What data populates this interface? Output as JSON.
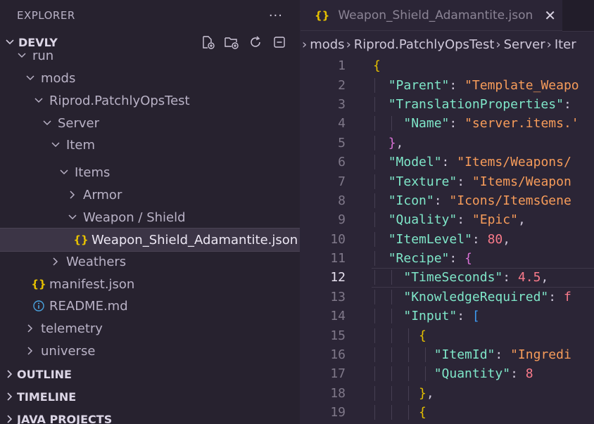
{
  "explorer": {
    "title": "EXPLORER",
    "more": "···"
  },
  "workspace": {
    "name": "DEVLY"
  },
  "tree": [
    {
      "label": "run",
      "depth": 1,
      "type": "folder",
      "expanded": true
    },
    {
      "label": "mods",
      "depth": 2,
      "type": "folder",
      "expanded": true
    },
    {
      "label": "Riprod.PatchlyOpsTest",
      "depth": 3,
      "type": "folder",
      "expanded": true
    },
    {
      "label": "Server",
      "depth": 4,
      "type": "folder",
      "expanded": true
    },
    {
      "label": "Item",
      "depth": 5,
      "type": "folder",
      "expanded": true
    },
    {
      "label": "Items",
      "depth": 6,
      "type": "folder",
      "expanded": true
    },
    {
      "label": "Armor",
      "depth": 7,
      "type": "folder",
      "expanded": false
    },
    {
      "label": "Weapon / Shield",
      "depth": 7,
      "type": "folder",
      "expanded": true
    },
    {
      "label": "Weapon_Shield_Adamantite.json",
      "depth": 8,
      "type": "json",
      "selected": true
    },
    {
      "label": "Weathers",
      "depth": 5,
      "type": "folder",
      "expanded": false
    },
    {
      "label": "manifest.json",
      "depth": 3,
      "type": "json"
    },
    {
      "label": "README.md",
      "depth": 3,
      "type": "info"
    },
    {
      "label": "telemetry",
      "depth": 2,
      "type": "folder",
      "expanded": false
    },
    {
      "label": "universe",
      "depth": 2,
      "type": "folder",
      "expanded": false
    }
  ],
  "sections": [
    "OUTLINE",
    "TIMELINE",
    "JAVA PROJECTS"
  ],
  "tab": {
    "label": "Weapon_Shield_Adamantite.json",
    "brace": "{}",
    "close": "✕"
  },
  "breadcrumbs": [
    "mods",
    "Riprod.PatchlyOpsTest",
    "Server",
    "Iter"
  ],
  "active_line": 12,
  "code_lines": [
    {
      "n": 1,
      "indent": 0,
      "tokens": [
        [
          "b1",
          "{"
        ]
      ]
    },
    {
      "n": 2,
      "indent": 1,
      "tokens": [
        [
          "k",
          "\"Parent\""
        ],
        [
          "p",
          ": "
        ],
        [
          "s",
          "\"Template_Weapo"
        ]
      ]
    },
    {
      "n": 3,
      "indent": 1,
      "tokens": [
        [
          "k",
          "\"TranslationProperties\""
        ],
        [
          "p",
          ":"
        ]
      ]
    },
    {
      "n": 4,
      "indent": 2,
      "tokens": [
        [
          "k",
          "\"Name\""
        ],
        [
          "p",
          ": "
        ],
        [
          "s",
          "\"server.items.'"
        ]
      ]
    },
    {
      "n": 5,
      "indent": 1,
      "tokens": [
        [
          "b2",
          "}"
        ],
        [
          "p",
          ","
        ]
      ]
    },
    {
      "n": 6,
      "indent": 1,
      "tokens": [
        [
          "k",
          "\"Model\""
        ],
        [
          "p",
          ": "
        ],
        [
          "s",
          "\"Items/Weapons/"
        ]
      ]
    },
    {
      "n": 7,
      "indent": 1,
      "tokens": [
        [
          "k",
          "\"Texture\""
        ],
        [
          "p",
          ": "
        ],
        [
          "s",
          "\"Items/Weapon"
        ]
      ]
    },
    {
      "n": 8,
      "indent": 1,
      "tokens": [
        [
          "k",
          "\"Icon\""
        ],
        [
          "p",
          ": "
        ],
        [
          "s",
          "\"Icons/ItemsGene"
        ]
      ]
    },
    {
      "n": 9,
      "indent": 1,
      "tokens": [
        [
          "k",
          "\"Quality\""
        ],
        [
          "p",
          ": "
        ],
        [
          "s",
          "\"Epic\""
        ],
        [
          "p",
          ","
        ]
      ]
    },
    {
      "n": 10,
      "indent": 1,
      "tokens": [
        [
          "k",
          "\"ItemLevel\""
        ],
        [
          "p",
          ": "
        ],
        [
          "n",
          "80"
        ],
        [
          "p",
          ","
        ]
      ]
    },
    {
      "n": 11,
      "indent": 1,
      "tokens": [
        [
          "k",
          "\"Recipe\""
        ],
        [
          "p",
          ": "
        ],
        [
          "b2",
          "{"
        ]
      ]
    },
    {
      "n": 12,
      "indent": 2,
      "tokens": [
        [
          "k",
          "\"TimeSeconds\""
        ],
        [
          "p",
          ": "
        ],
        [
          "n",
          "4.5"
        ],
        [
          "p",
          ","
        ]
      ]
    },
    {
      "n": 13,
      "indent": 2,
      "tokens": [
        [
          "k",
          "\"KnowledgeRequired\""
        ],
        [
          "p",
          ": "
        ],
        [
          "n",
          "f"
        ]
      ]
    },
    {
      "n": 14,
      "indent": 2,
      "tokens": [
        [
          "k",
          "\"Input\""
        ],
        [
          "p",
          ": "
        ],
        [
          "b3",
          "["
        ]
      ]
    },
    {
      "n": 15,
      "indent": 3,
      "tokens": [
        [
          "b1",
          "{"
        ]
      ]
    },
    {
      "n": 16,
      "indent": 4,
      "tokens": [
        [
          "k",
          "\"ItemId\""
        ],
        [
          "p",
          ": "
        ],
        [
          "s",
          "\"Ingredi"
        ]
      ]
    },
    {
      "n": 17,
      "indent": 4,
      "tokens": [
        [
          "k",
          "\"Quantity\""
        ],
        [
          "p",
          ": "
        ],
        [
          "n",
          "8"
        ]
      ]
    },
    {
      "n": 18,
      "indent": 3,
      "tokens": [
        [
          "b1",
          "}"
        ],
        [
          "p",
          ","
        ]
      ]
    },
    {
      "n": 19,
      "indent": 3,
      "tokens": [
        [
          "b1",
          "{"
        ]
      ]
    }
  ],
  "colors": {
    "key": "#7fe7c9",
    "string": "#f79c5a",
    "number": "#f97a8a",
    "brace_yellow": "#e5c000",
    "brace_magenta": "#d971d6",
    "bracket_blue": "#3d9bf2"
  }
}
